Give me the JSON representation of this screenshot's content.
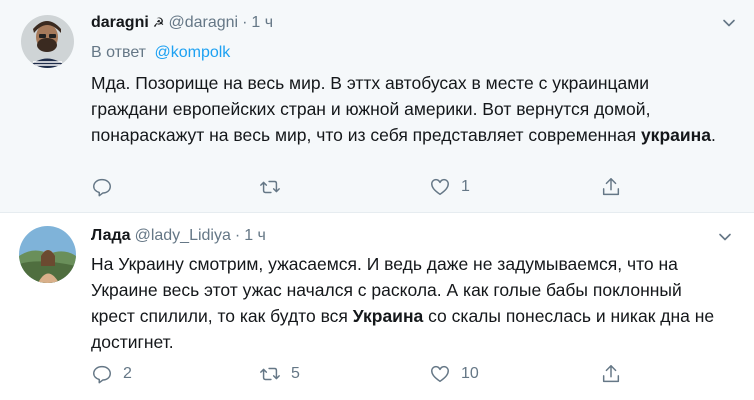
{
  "tweets": [
    {
      "name": "daragni",
      "name_symbol": "☭",
      "handle": "@daragni",
      "separator": "·",
      "time": "1 ч",
      "reply_prefix": "В ответ",
      "reply_mention": "@kompolk",
      "text_plain": "Мда. Позорище на весь мир. В эттх автобусах в месте с украинцами граждани европейских стран и южной америки. Вот вернутся домой, понараскажут на весь мир, что из себя представляет современная ",
      "text_bold": "украина",
      "text_after": ".",
      "reply_count": "",
      "retweet_count": "",
      "like_count": "1"
    },
    {
      "name": "Лада",
      "handle": "@lady_Lidiya",
      "separator": "·",
      "time": "1 ч",
      "text_plain": "На Украину смотрим, ужасаемся. И ведь даже не задумываемся, что на Украине весь этот ужас начался с раскола. А как голые бабы поклонный крест спилили, то как будто вся ",
      "text_bold": "Украина",
      "text_after": " со скалы понеслась и никак дна не достигнет.",
      "reply_count": "2",
      "retweet_count": "5",
      "like_count": "10"
    }
  ],
  "icons": {
    "reply": "reply-icon",
    "retweet": "retweet-icon",
    "like": "heart-icon",
    "share": "share-icon",
    "more": "chevron-down-icon"
  },
  "colors": {
    "muted": "#657786",
    "link": "#1da1f2",
    "text": "#14171a"
  }
}
